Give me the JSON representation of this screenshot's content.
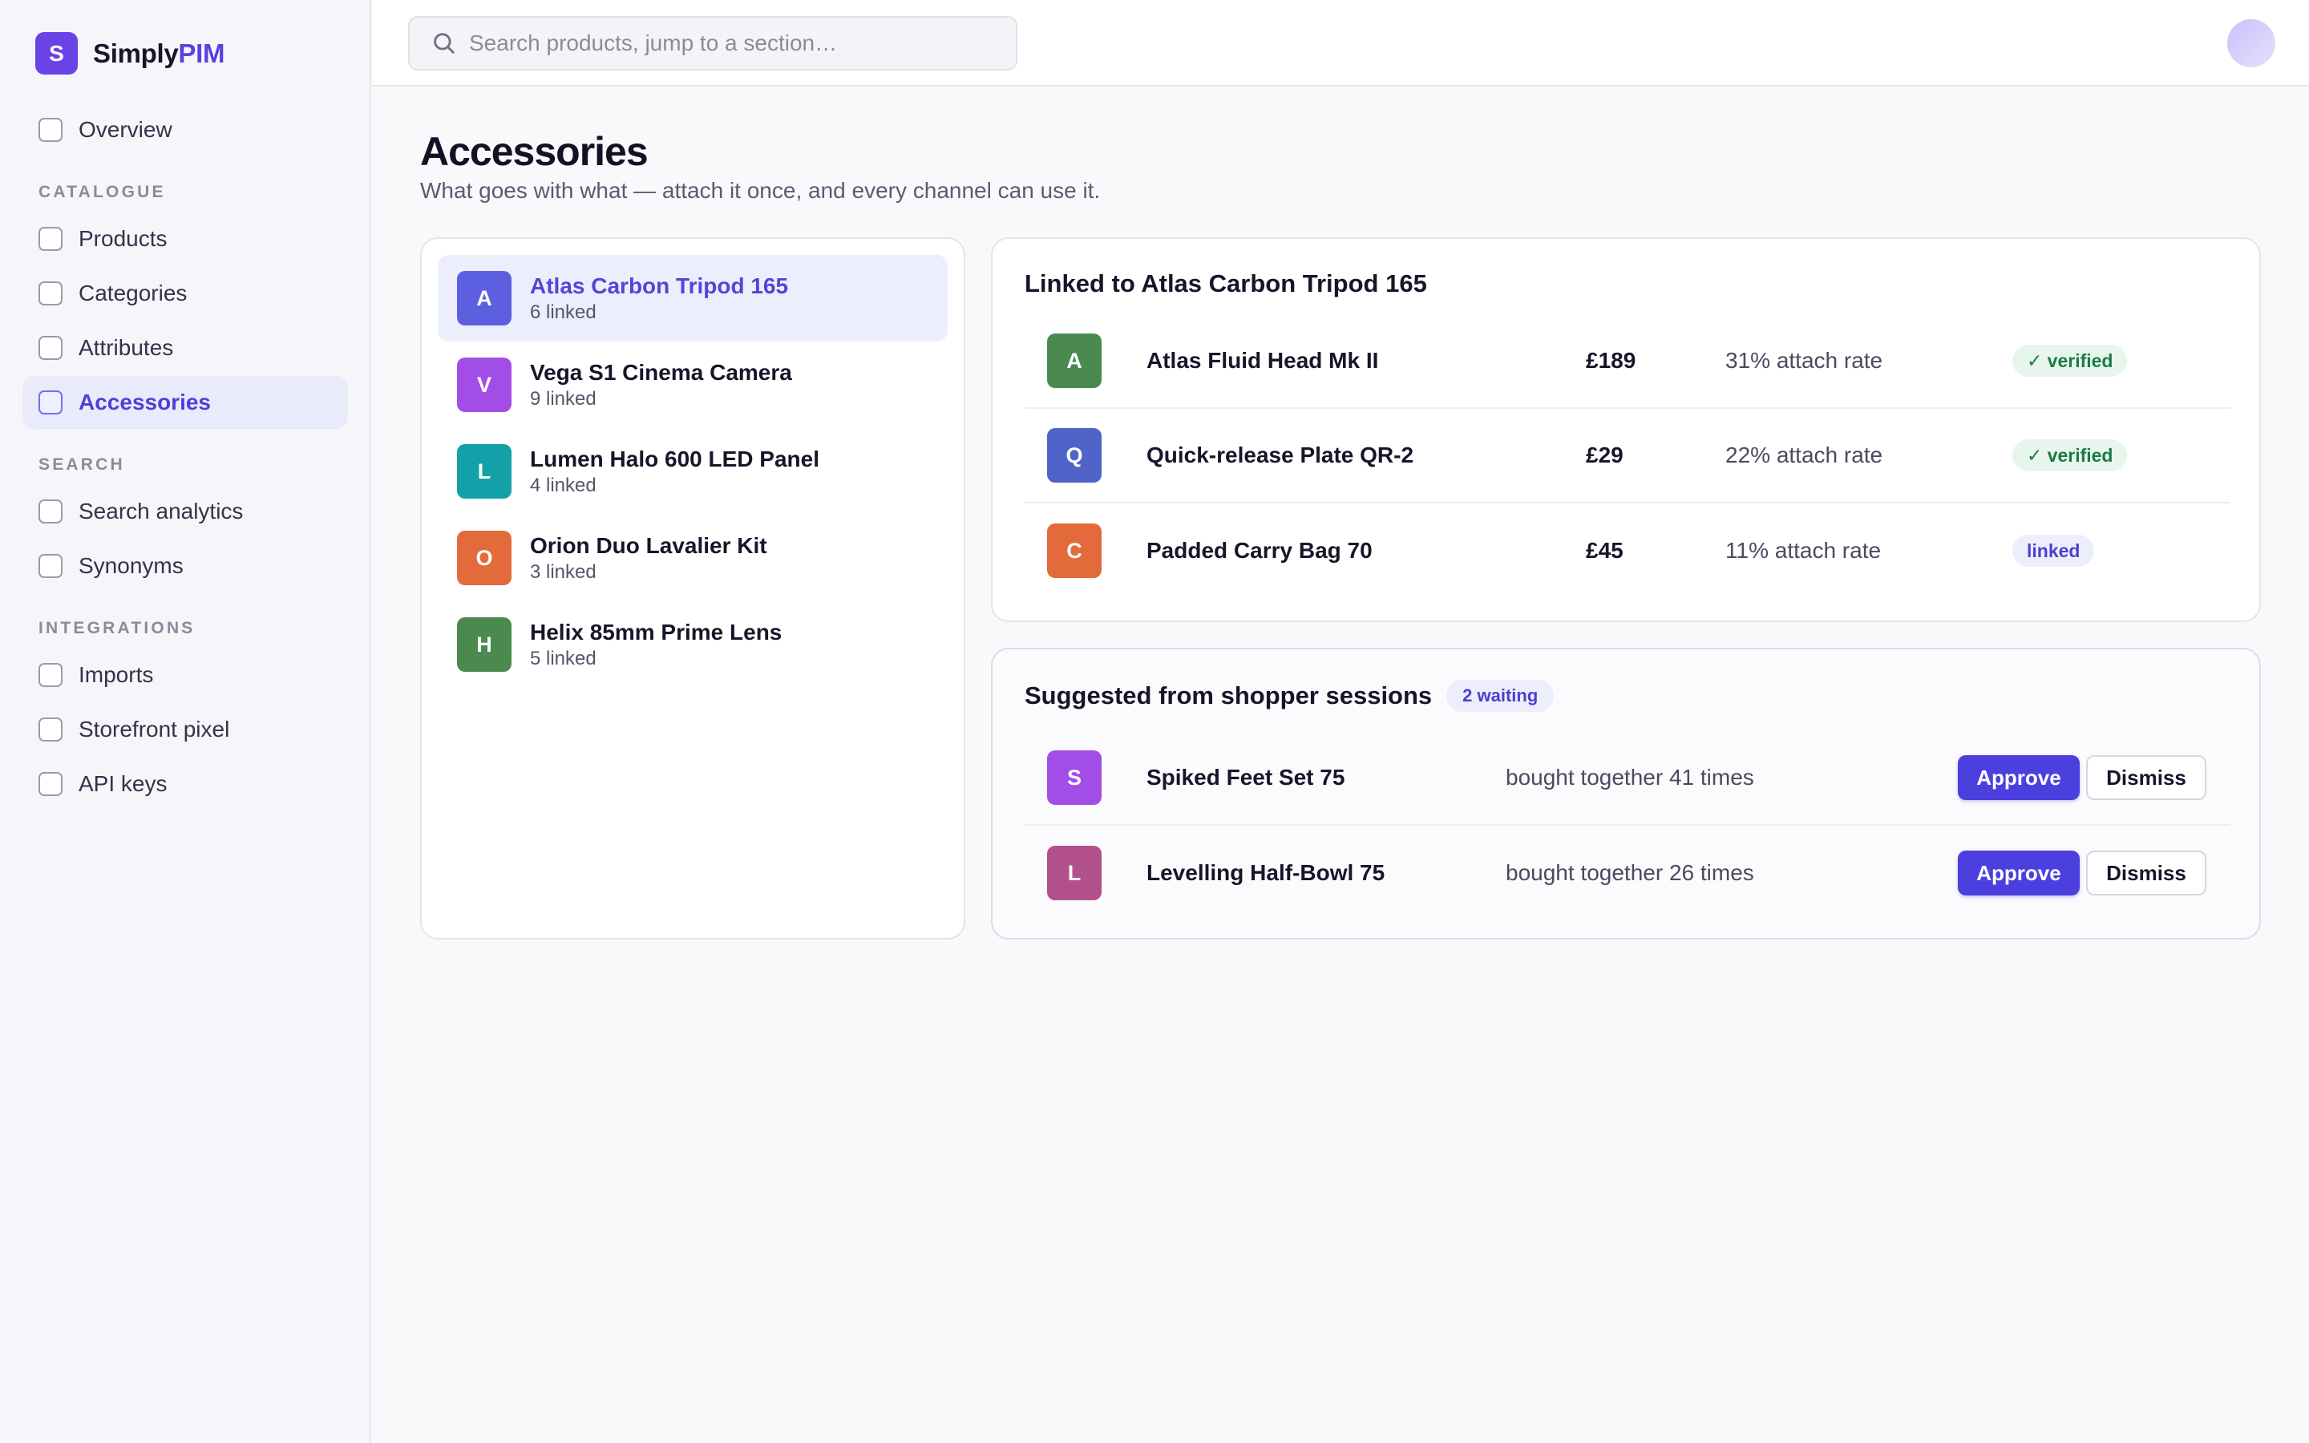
{
  "app": {
    "brand_initial": "S",
    "brand_prefix": "Simply",
    "brand_accent": "PIM"
  },
  "sidebar": {
    "overview": "Overview",
    "sections": {
      "catalogue": "CATALOGUE",
      "search": "SEARCH",
      "integrations": "INTEGRATIONS"
    },
    "items": [
      {
        "label": "Products"
      },
      {
        "label": "Categories"
      },
      {
        "label": "Attributes"
      },
      {
        "label": "Accessories",
        "active": true
      },
      {
        "label": "Search analytics"
      },
      {
        "label": "Synonyms"
      },
      {
        "label": "Imports"
      },
      {
        "label": "Storefront pixel"
      },
      {
        "label": "API keys"
      }
    ]
  },
  "search": {
    "placeholder": "Search products, jump to a section…"
  },
  "page": {
    "title": "Accessories",
    "subtitle": "What goes with what — attach it once, and every channel can use it."
  },
  "products": [
    {
      "initial": "A",
      "name": "Atlas Carbon Tripod 165",
      "meta": "6 linked",
      "color": "#5b5fe0",
      "active": true
    },
    {
      "initial": "V",
      "name": "Vega S1 Cinema Camera",
      "meta": "9 linked",
      "color": "#a24ee6"
    },
    {
      "initial": "L",
      "name": "Lumen Halo 600 LED Panel",
      "meta": "4 linked",
      "color": "#14a0a8"
    },
    {
      "initial": "O",
      "name": "Orion Duo Lavalier Kit",
      "meta": "3 linked",
      "color": "#e26a3b"
    },
    {
      "initial": "H",
      "name": "Helix 85mm Prime Lens",
      "meta": "5 linked",
      "color": "#4b8a4f"
    }
  ],
  "linked": {
    "heading": "Linked to Atlas Carbon Tripod 165",
    "rows": [
      {
        "initial": "A",
        "name": "Atlas Fluid Head Mk II",
        "price": "£189",
        "rate": "31% attach rate",
        "status": "✓ verified",
        "status_type": "verified",
        "color": "#4b8a4f"
      },
      {
        "initial": "Q",
        "name": "Quick-release Plate QR-2",
        "price": "£29",
        "rate": "22% attach rate",
        "status": "✓ verified",
        "status_type": "verified",
        "color": "#4f63c9"
      },
      {
        "initial": "C",
        "name": "Padded Carry Bag 70",
        "price": "£45",
        "rate": "11% attach rate",
        "status": "linked",
        "status_type": "linked",
        "color": "#e26a3b"
      }
    ]
  },
  "suggested": {
    "heading": "Suggested from shopper sessions",
    "badge": "2 waiting",
    "approve_label": "Approve",
    "dismiss_label": "Dismiss",
    "rows": [
      {
        "initial": "S",
        "name": "Spiked Feet Set 75",
        "times": "bought together 41 times",
        "color": "#a24ee6"
      },
      {
        "initial": "L",
        "name": "Levelling Half-Bowl 75",
        "times": "bought together 26 times",
        "color": "#b2508c"
      }
    ]
  }
}
